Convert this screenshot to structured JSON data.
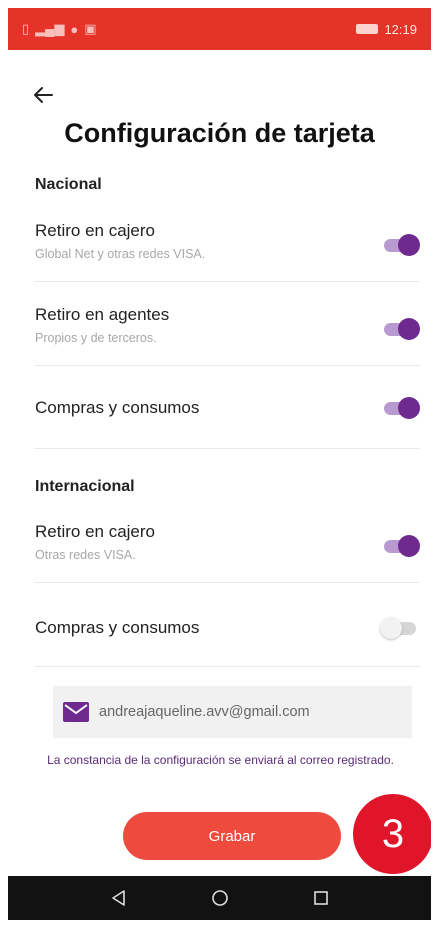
{
  "status_bar": {
    "left_icons": [
      "sim-icon",
      "signal-icon",
      "notification-icon",
      "screenshot-icon"
    ],
    "time": "12:19"
  },
  "header": {
    "title": "Configuración de tarjeta"
  },
  "sections": [
    {
      "label": "Nacional",
      "items": [
        {
          "title": "Retiro en cajero",
          "subtitle": "Global Net y otras redes VISA.",
          "enabled": true
        },
        {
          "title": "Retiro en agentes",
          "subtitle": "Propios y de terceros.",
          "enabled": true
        },
        {
          "title": "Compras y consumos",
          "subtitle": "",
          "enabled": true
        }
      ]
    },
    {
      "label": "Internacional",
      "items": [
        {
          "title": "Retiro en cajero",
          "subtitle": "Otras redes VISA.",
          "enabled": true
        },
        {
          "title": "Compras y consumos",
          "subtitle": "",
          "enabled": false
        }
      ]
    }
  ],
  "email": {
    "icon": "mail-icon",
    "value": "andreajaqueline.avv@gmail.com"
  },
  "notice": "La constancia de la configuración se enviará al correo registrado.",
  "save_label": "Grabar",
  "step_badge": "3",
  "colors": {
    "status_bar": "#e5332a",
    "toggle_on": "#6e2a8e",
    "button": "#ef4a3e",
    "badge": "#e0152a"
  }
}
